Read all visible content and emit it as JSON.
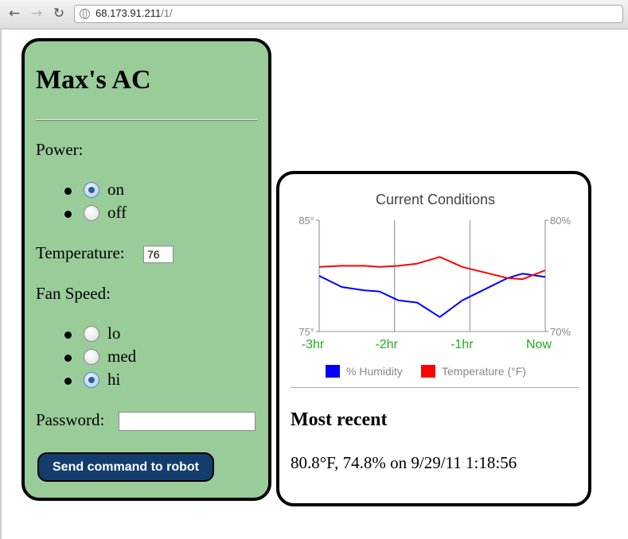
{
  "browser": {
    "url_host": "68.173.91.211",
    "url_path": "/1/"
  },
  "control": {
    "title": "Max's AC",
    "power_label": "Power:",
    "power_options": [
      {
        "label": "on",
        "checked": true
      },
      {
        "label": "off",
        "checked": false
      }
    ],
    "temperature_label": "Temperature:",
    "temperature_value": "76",
    "fan_label": "Fan Speed:",
    "fan_options": [
      {
        "label": "lo",
        "checked": false
      },
      {
        "label": "med",
        "checked": false
      },
      {
        "label": "hi",
        "checked": true
      }
    ],
    "password_label": "Password:",
    "password_value": "",
    "send_label": "Send command to robot"
  },
  "chart_data": {
    "type": "line",
    "title": "Current Conditions",
    "x_tick_labels": [
      "-3hr",
      "-2hr",
      "-1hr",
      "Now"
    ],
    "left_axis": {
      "ylim": [
        75,
        85
      ],
      "tick_labels": [
        "85°",
        "75°"
      ]
    },
    "right_axis": {
      "ylim": [
        70,
        80
      ],
      "tick_labels": [
        "80%",
        "70%"
      ]
    },
    "x": [
      -3.0,
      -2.7,
      -2.4,
      -2.2,
      -1.95,
      -1.7,
      -1.4,
      -1.1,
      -0.8,
      -0.5,
      -0.3,
      0.0
    ],
    "series": [
      {
        "name": "% Humidity",
        "color": "#0000ff",
        "axis": "right",
        "values": [
          75.0,
          74.0,
          73.7,
          73.6,
          72.8,
          72.6,
          71.3,
          72.8,
          73.8,
          74.8,
          75.2,
          74.9
        ]
      },
      {
        "name": "Temperature (°F)",
        "color": "#ff0000",
        "axis": "left",
        "values": [
          80.8,
          80.9,
          80.9,
          80.8,
          80.9,
          81.1,
          81.7,
          80.8,
          80.3,
          79.8,
          79.7,
          80.5
        ]
      }
    ],
    "legend_position": "bottom",
    "grid": "vertical"
  },
  "recent": {
    "heading": "Most recent",
    "value": "80.8°F, 74.8% on 9/29/11 1:18:56"
  }
}
